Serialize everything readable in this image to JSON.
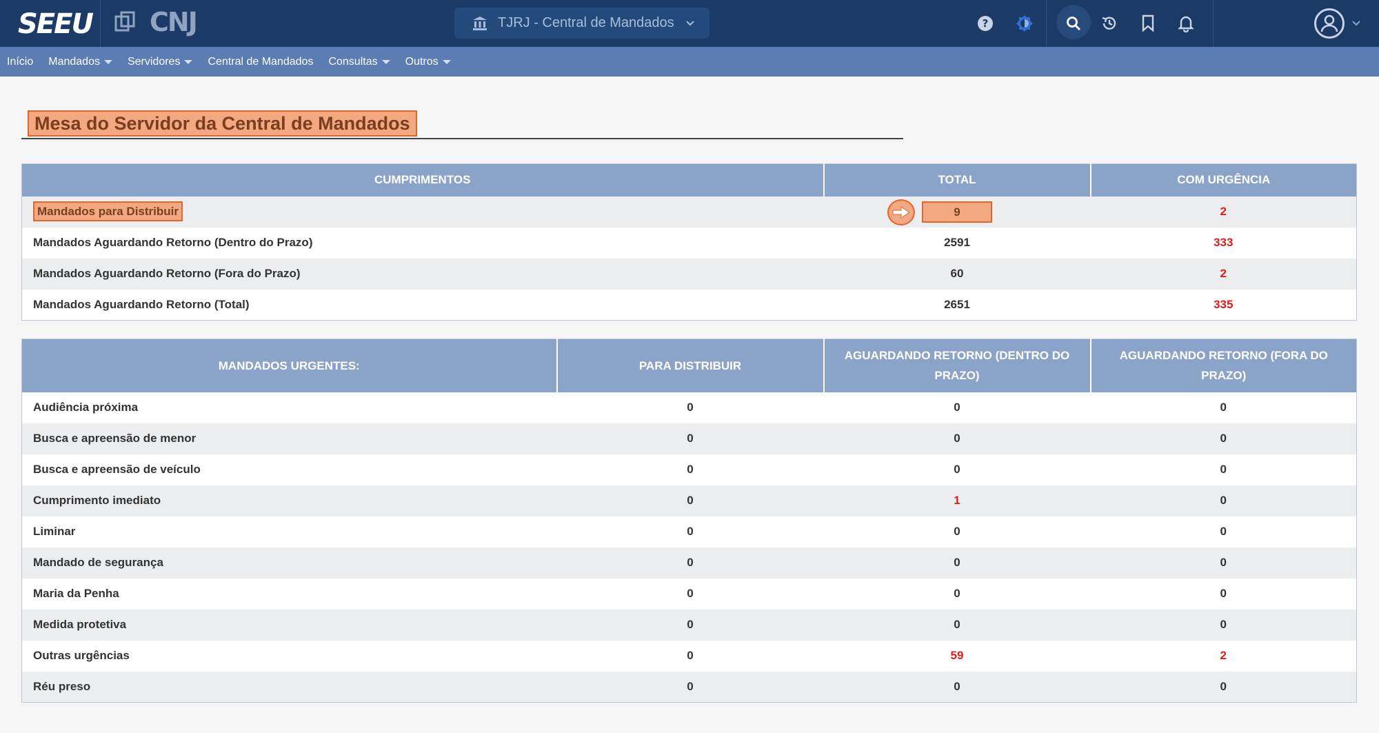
{
  "header": {
    "logo_seeu": "SEEU",
    "logo_cnj": "CNJ",
    "unit_selector": "TJRJ - Central de Mandados",
    "icons": [
      "help-icon",
      "contrast-icon",
      "search-icon",
      "history-icon",
      "bookmark-icon",
      "bell-icon",
      "user-avatar-icon"
    ]
  },
  "menu": {
    "items": [
      {
        "label": "Início",
        "dropdown": false
      },
      {
        "label": "Mandados",
        "dropdown": true
      },
      {
        "label": "Servidores",
        "dropdown": true
      },
      {
        "label": "Central de Mandados",
        "dropdown": false
      },
      {
        "label": "Consultas",
        "dropdown": true
      },
      {
        "label": "Outros",
        "dropdown": true
      }
    ]
  },
  "page": {
    "title": "Mesa do Servidor da Central de Mandados"
  },
  "cumprimentos": {
    "headers": [
      "CUMPRIMENTOS",
      "TOTAL",
      "COM URGÊNCIA"
    ],
    "rows": [
      {
        "label": "Mandados para Distribuir",
        "total": "9",
        "urgent": "2"
      },
      {
        "label": "Mandados Aguardando Retorno (Dentro do Prazo)",
        "total": "2591",
        "urgent": "333"
      },
      {
        "label": "Mandados Aguardando Retorno (Fora do Prazo)",
        "total": "60",
        "urgent": "2"
      },
      {
        "label": "Mandados Aguardando Retorno (Total)",
        "total": "2651",
        "urgent": "335"
      }
    ]
  },
  "urgentes": {
    "headers": [
      "MANDADOS URGENTES:",
      "PARA DISTRIBUIR",
      "AGUARDANDO RETORNO (DENTRO DO PRAZO)",
      "AGUARDANDO RETORNO (FORA DO PRAZO)"
    ],
    "rows": [
      {
        "label": "Audiência próxima",
        "distribuir": "0",
        "dentro": "0",
        "fora": "0"
      },
      {
        "label": "Busca e apreensão de menor",
        "distribuir": "0",
        "dentro": "0",
        "fora": "0"
      },
      {
        "label": "Busca e apreensão de veículo",
        "distribuir": "0",
        "dentro": "0",
        "fora": "0"
      },
      {
        "label": "Cumprimento imediato",
        "distribuir": "0",
        "dentro": "1",
        "fora": "0"
      },
      {
        "label": "Liminar",
        "distribuir": "0",
        "dentro": "0",
        "fora": "0"
      },
      {
        "label": "Mandado de segurança",
        "distribuir": "0",
        "dentro": "0",
        "fora": "0"
      },
      {
        "label": "Maria da Penha",
        "distribuir": "0",
        "dentro": "0",
        "fora": "0"
      },
      {
        "label": "Medida protetiva",
        "distribuir": "0",
        "dentro": "0",
        "fora": "0"
      },
      {
        "label": "Outras urgências",
        "distribuir": "0",
        "dentro": "59",
        "fora": "2"
      },
      {
        "label": "Réu preso",
        "distribuir": "0",
        "dentro": "0",
        "fora": "0"
      }
    ]
  },
  "colors": {
    "topbar": "#1b3a66",
    "menubar": "#5b7db3",
    "table_header": "#8aa4c9",
    "highlight_fill": "#f2a880",
    "highlight_border": "#e0662a",
    "alert_red": "#e31b1b"
  }
}
